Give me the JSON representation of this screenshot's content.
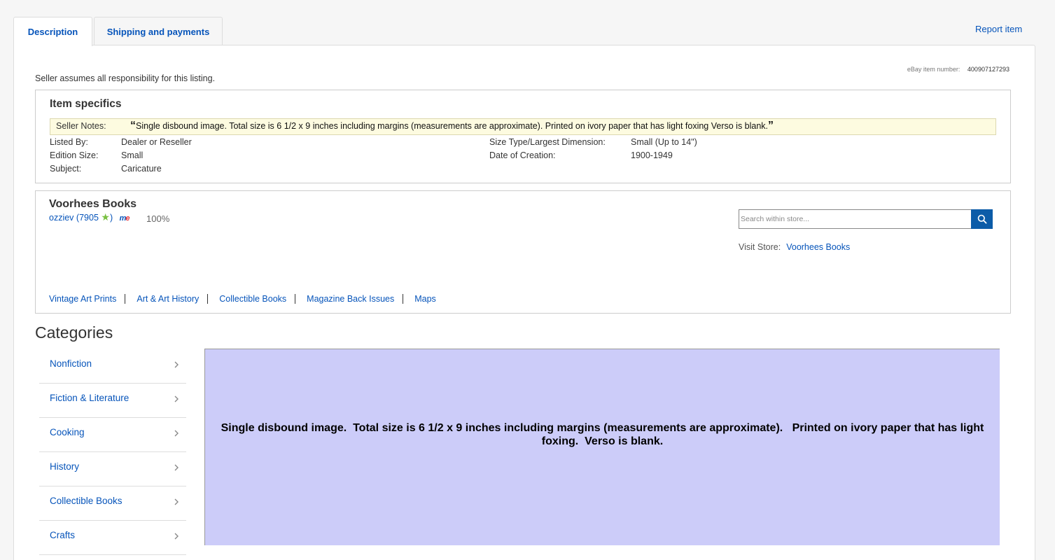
{
  "tabs": {
    "description": "Description",
    "shipping": "Shipping and payments"
  },
  "report_item": "Report item",
  "item_number": {
    "label": "eBay item number:",
    "value": "400907127293"
  },
  "seller_responsibility": "Seller assumes all responsibility for this listing.",
  "item_specifics": {
    "title": "Item specifics",
    "seller_notes_label": "Seller Notes:",
    "seller_notes_text": "Single disbound image. Total size is 6 1/2 x 9 inches including margins (measurements are approximate). Printed on ivory paper that has light foxing Verso is blank.",
    "open_quote": "“",
    "close_quote": "”",
    "rows": [
      {
        "label": "Listed By:",
        "value": "Dealer or Reseller"
      },
      {
        "label": "Edition Size:",
        "value": "Small"
      },
      {
        "label": "Subject:",
        "value": "Caricature"
      },
      {
        "label": "Size Type/Largest Dimension:",
        "value": "Small (Up to 14\")"
      },
      {
        "label": "Date of Creation:",
        "value": "1900-1949"
      }
    ]
  },
  "store": {
    "name": "Voorhees Books",
    "seller_id": "ozziev",
    "feedback_score": "7905",
    "open_paren": "(",
    "close_paren": ")",
    "positive_pct": "100%",
    "search_placeholder": "Search within store...",
    "visit_label": "Visit Store:",
    "visit_link": "Voorhees Books",
    "categories": [
      "Vintage Art Prints",
      "Art & Art History",
      "Collectible Books",
      "Magazine Back Issues",
      "Maps"
    ]
  },
  "categories": {
    "title": "Categories",
    "items": [
      "Nonfiction",
      "Fiction & Literature",
      "Cooking",
      "History",
      "Collectible Books",
      "Crafts"
    ]
  },
  "description_text": "Single disbound image.  Total size is 6 1/2 x 9 inches including margins (measurements are approximate).   Printed on ivory paper that has light foxing.  Verso is blank.",
  "colors": {
    "link": "#0654ba",
    "search_button": "#0c5ca8",
    "description_bg": "#ccccf9",
    "notes_bg": "#fdfbe0",
    "star": "#78c040"
  },
  "icons": [
    "search-icon",
    "star-icon",
    "me-icon",
    "chevron-right-icon"
  ]
}
